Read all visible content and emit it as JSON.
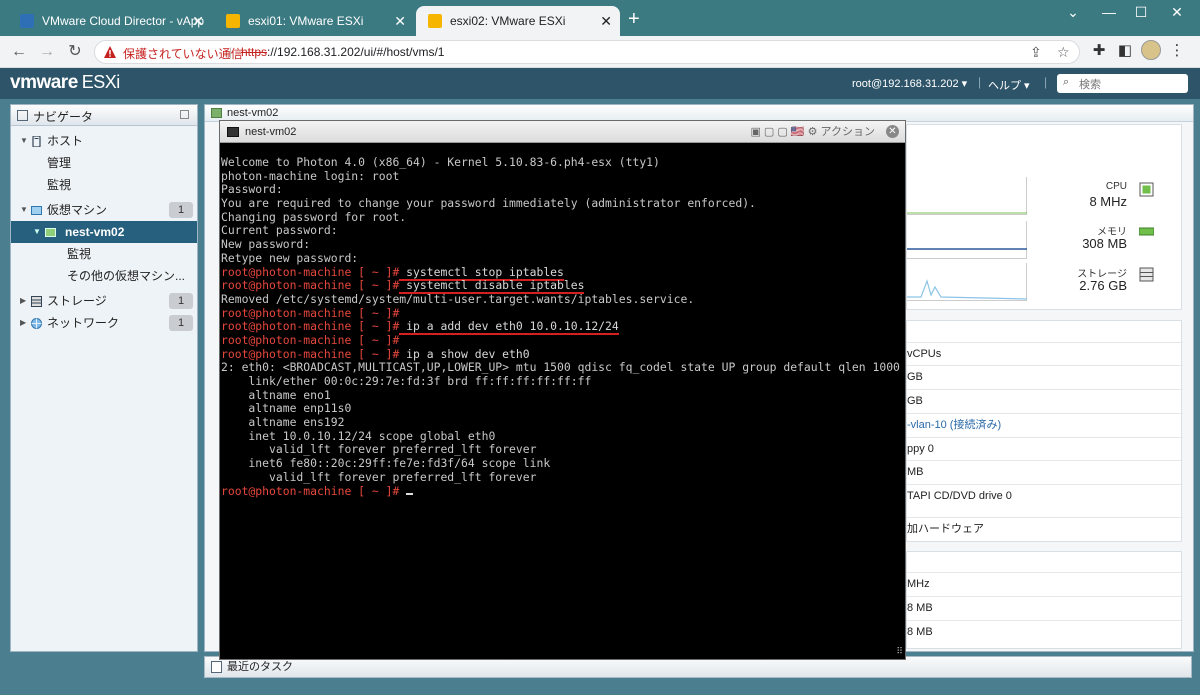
{
  "browser": {
    "tabs": [
      {
        "title": "VMware Cloud Director - vApp",
        "active": false
      },
      {
        "title": "esxi01: VMware ESXi",
        "active": false
      },
      {
        "title": "esxi02: VMware ESXi",
        "active": true
      }
    ],
    "security_warning": "保護されていない通信",
    "url_scheme": "https",
    "url_rest": "://192.168.31.202/ui/#/host/vms/1"
  },
  "esxi": {
    "logo_vm": "vmware",
    "logo_product": "ESXi",
    "user": "root@192.168.31.202",
    "help": "ヘルプ",
    "search_placeholder": "検索"
  },
  "navigator": {
    "title": "ナビゲータ",
    "items": [
      {
        "label": "ホスト"
      },
      {
        "label": "管理"
      },
      {
        "label": "監視"
      },
      {
        "label": "仮想マシン",
        "count": "1"
      },
      {
        "label": "nest-vm02"
      },
      {
        "label": "監視"
      },
      {
        "label": "その他の仮想マシン..."
      },
      {
        "label": "ストレージ",
        "count": "1"
      },
      {
        "label": "ネットワーク",
        "count": "1"
      }
    ]
  },
  "content": {
    "tab_title": "nest-vm02",
    "metrics": [
      {
        "label": "CPU",
        "value": "8 MHz"
      },
      {
        "label": "メモリ",
        "value": "308 MB"
      },
      {
        "label": "ストレージ",
        "value": "2.76 GB"
      }
    ],
    "hardware_rows": [
      "vCPUs",
      "GB",
      "GB",
      "-vlan-10 (接続済み)",
      "ppy 0",
      "MB",
      "TAPI CD/DVD drive 0",
      "加ハードウェア"
    ],
    "resource_rows": [
      "MHz",
      "8 MB",
      "8 MB"
    ],
    "recent_tasks": "最近のタスク"
  },
  "console": {
    "title": "nest-vm02",
    "action_label": "アクション",
    "lines": [
      {
        "text": "Welcome to Photon 4.0 (x86_64) - Kernel 5.10.83-6.ph4-esx (tty1)"
      },
      {
        "text": "photon-machine login: root"
      },
      {
        "text": "Password:"
      },
      {
        "text": "You are required to change your password immediately (administrator enforced)."
      },
      {
        "text": "Changing password for root."
      },
      {
        "text": "Current password:"
      },
      {
        "text": "New password:"
      },
      {
        "text": "Retype new password:"
      },
      {
        "prompt": "root@photon-machine [ ~ ]#",
        "cmd": " systemctl stop iptables",
        "underline": true
      },
      {
        "prompt": "root@photon-machine [ ~ ]#",
        "cmd": " systemctl disable iptables",
        "underline": true
      },
      {
        "text": "Removed /etc/systemd/system/multi-user.target.wants/iptables.service."
      },
      {
        "prompt": "root@photon-machine [ ~ ]#",
        "cmd": ""
      },
      {
        "prompt": "root@photon-machine [ ~ ]#",
        "cmd": " ip a add dev eth0 10.0.10.12/24",
        "underline": true
      },
      {
        "prompt": "root@photon-machine [ ~ ]#",
        "cmd": ""
      },
      {
        "prompt": "root@photon-machine [ ~ ]#",
        "cmd": " ip a show dev eth0"
      },
      {
        "text": "2: eth0: <BROADCAST,MULTICAST,UP,LOWER_UP> mtu 1500 qdisc fq_codel state UP group default qlen 1000"
      },
      {
        "text": "    link/ether 00:0c:29:7e:fd:3f brd ff:ff:ff:ff:ff:ff"
      },
      {
        "text": "    altname eno1"
      },
      {
        "text": "    altname enp11s0"
      },
      {
        "text": "    altname ens192"
      },
      {
        "text": "    inet 10.0.10.12/24 scope global eth0"
      },
      {
        "text": "       valid_lft forever preferred_lft forever"
      },
      {
        "text": "    inet6 fe80::20c:29ff:fe7e:fd3f/64 scope link"
      },
      {
        "text": "       valid_lft forever preferred_lft forever"
      },
      {
        "prompt": "root@photon-machine [ ~ ]#",
        "cmd": " ",
        "cursor": true
      }
    ]
  },
  "colors": {
    "esxi_header": "#2d5468",
    "nav_selected": "#27607e",
    "prompt_red": "#e6473d",
    "underline_red": "#d61f1f"
  }
}
